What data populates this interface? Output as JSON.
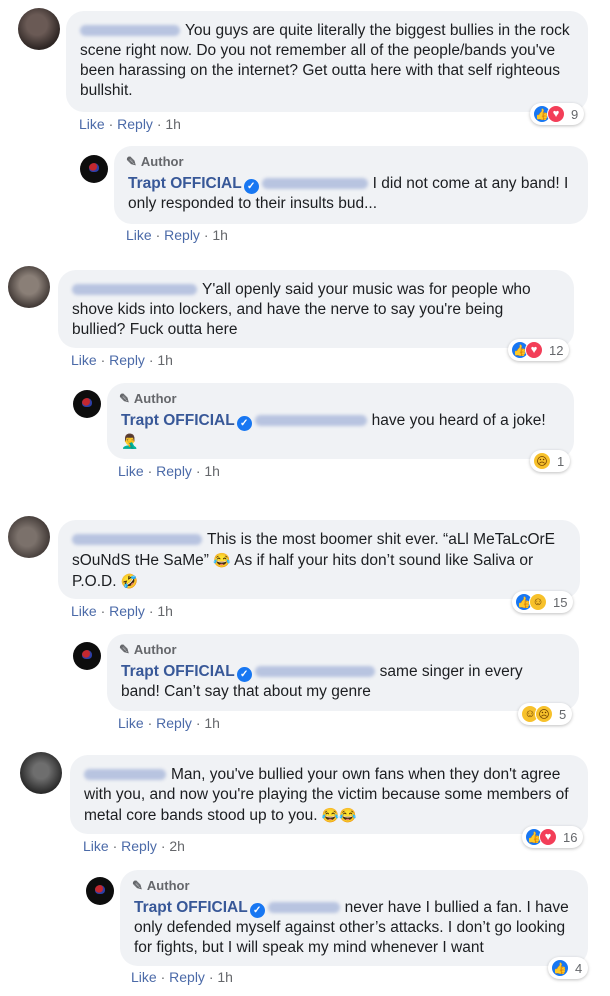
{
  "comments": [
    {
      "text": "You guys are quite literally the biggest bullies in the rock scene right now. Do you not remember all of the people/bands you've been harassing on the internet? Get outta here with that self righteous bullshit.",
      "like": "Like",
      "reply": "Reply",
      "time": "1h",
      "reaction_count": "9",
      "reply_obj": {
        "author_badge": "Author",
        "name": "Trapt OFFICIAL",
        "text": "I did not come at any band! I only responded to their insults bud...",
        "like": "Like",
        "reply": "Reply",
        "time": "1h"
      }
    },
    {
      "text": "Y'all openly said your music was for people who shove kids into lockers, and have the nerve to say you're being bullied? Fuck outta here",
      "like": "Like",
      "reply": "Reply",
      "time": "1h",
      "reaction_count": "12",
      "reply_obj": {
        "author_badge": "Author",
        "name": "Trapt OFFICIAL",
        "text": "have you heard of a joke!",
        "emoji": "🤦‍♂️",
        "like": "Like",
        "reply": "Reply",
        "time": "1h",
        "reaction_count": "1"
      }
    },
    {
      "text_a": "This is the most boomer shit ever. “aLl MeTaLcOrE sOuNdS tHe SaMe”",
      "text_b": "As if half your hits don’t sound like Saliva or P.O.D.",
      "like": "Like",
      "reply": "Reply",
      "time": "1h",
      "reaction_count": "15",
      "reply_obj": {
        "author_badge": "Author",
        "name": "Trapt OFFICIAL",
        "text": "same singer in every band! Can’t say that about my genre",
        "like": "Like",
        "reply": "Reply",
        "time": "1h",
        "reaction_count": "5"
      }
    },
    {
      "text": "Man, you've bullied your own fans when they don't agree with you, and now you're playing the victim because some members of metal core bands stood up to you.",
      "like": "Like",
      "reply": "Reply",
      "time": "2h",
      "reaction_count": "16",
      "reply_obj": {
        "author_badge": "Author",
        "name": "Trapt OFFICIAL",
        "text": "never have I bullied a fan. I have only defended myself against other’s attacks. I don’t go looking for fights, but I will speak my mind whenever I want",
        "like": "Like",
        "reply": "Reply",
        "time": "1h",
        "reaction_count": "4"
      }
    }
  ],
  "separator": " · ",
  "emojis": {
    "laugh_cry": "😂",
    "rofl": "🤣",
    "sad": "😢",
    "haha": "😆"
  },
  "colors": {
    "bubble": "#f0f2f5",
    "link": "#385898",
    "like_blue": "#1877f2",
    "love_red": "#f33e58"
  }
}
